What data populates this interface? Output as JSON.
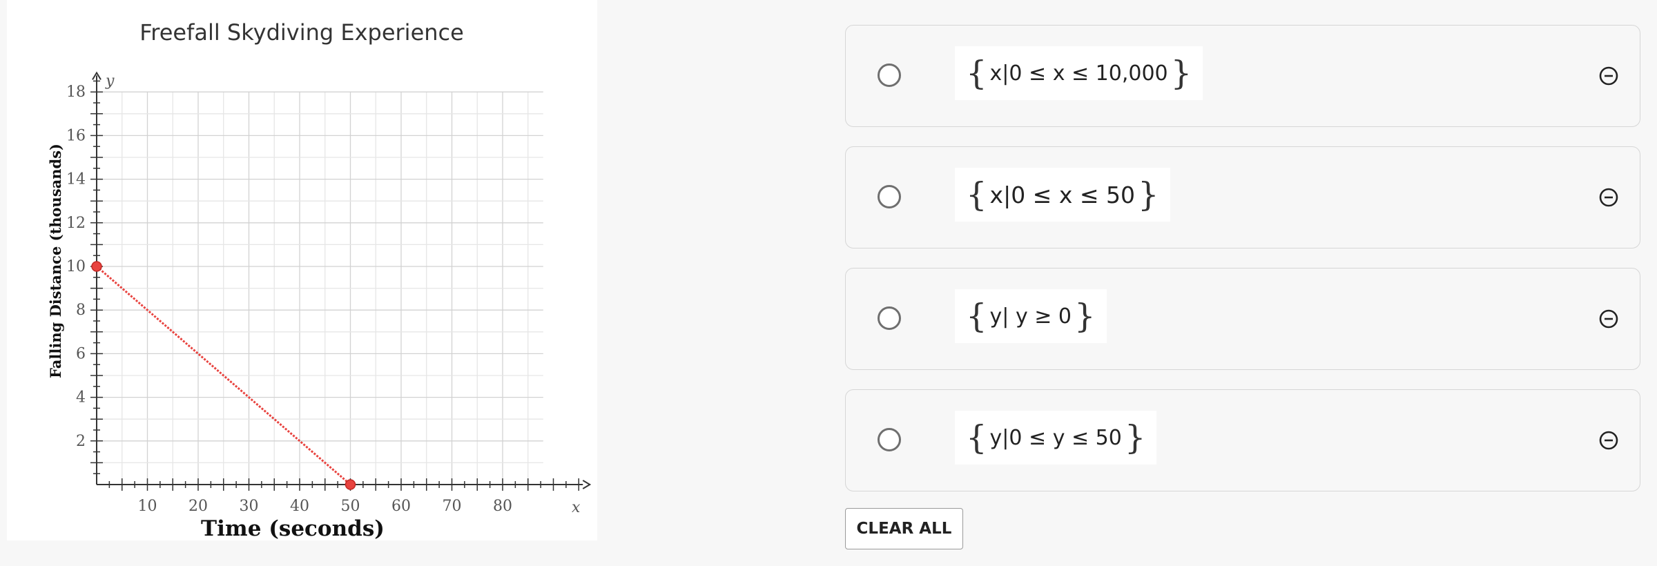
{
  "question": {
    "chart_data": {
      "type": "line",
      "title": "Freefall Skydiving Experience",
      "xlabel": "Time (seconds)",
      "ylabel": "Falling Distance (thousands)",
      "x_axis_letter": "x",
      "y_axis_letter": "y",
      "xlim": [
        0,
        95
      ],
      "ylim": [
        0,
        18.5
      ],
      "x_ticks": [
        10,
        20,
        30,
        40,
        50,
        60,
        70,
        80
      ],
      "y_ticks": [
        2,
        4,
        6,
        8,
        10,
        12,
        14,
        16,
        18
      ],
      "grid": true,
      "series": [
        {
          "x": [
            0,
            50
          ],
          "y": [
            10,
            0
          ],
          "color": "#e8433f"
        }
      ],
      "highlight_points": [
        {
          "x": 0,
          "y": 10
        },
        {
          "x": 50,
          "y": 0
        }
      ]
    }
  },
  "choices": [
    {
      "var": "x",
      "expression": "x|0 ≤ x ≤ 10,000"
    },
    {
      "var": "x",
      "expression": "x|0 ≤ x ≤ 50"
    },
    {
      "var": "y",
      "expression": "y| y ≥ 0"
    },
    {
      "var": "y",
      "expression": "y|0 ≤ y ≤ 50"
    }
  ],
  "choice_icons": {
    "radio": "radio-empty-icon",
    "eliminate": "minus-circle-icon"
  },
  "clear_all_label": "CLEAR ALL"
}
